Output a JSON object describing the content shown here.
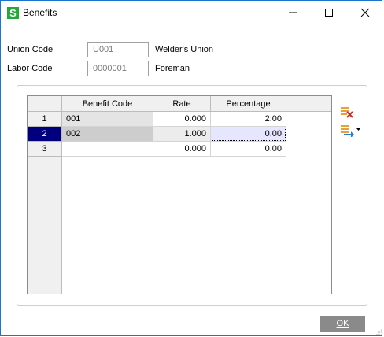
{
  "window": {
    "title": "Benefits",
    "app_icon_letter": "S",
    "controls": {
      "minimize": "—",
      "maximize": "☐",
      "close": "✕"
    }
  },
  "form": {
    "union_code_label": "Union Code",
    "union_code_value": "U001",
    "union_code_desc": "Welder's Union",
    "labor_code_label": "Labor Code",
    "labor_code_value": "0000001",
    "labor_code_desc": "Foreman"
  },
  "grid": {
    "columns": [
      "Benefit Code",
      "Rate",
      "Percentage"
    ],
    "rows": [
      {
        "num": "1",
        "benefit_code": "001",
        "rate": "0.000",
        "percentage": "2.00"
      },
      {
        "num": "2",
        "benefit_code": "002",
        "rate": "1.000",
        "percentage": "0.00"
      },
      {
        "num": "3",
        "benefit_code": "",
        "rate": "0.000",
        "percentage": "0.00"
      }
    ],
    "selected_row": 2
  },
  "toolbar": {
    "delete_icon": "delete-row-icon",
    "move_icon": "insert-row-icon"
  },
  "buttons": {
    "ok": "OK"
  },
  "colors": {
    "accent": "#1a75cf",
    "selected_row": "#00007f",
    "active_cell": "#e6e6ff",
    "app_icon": "#23a936"
  }
}
